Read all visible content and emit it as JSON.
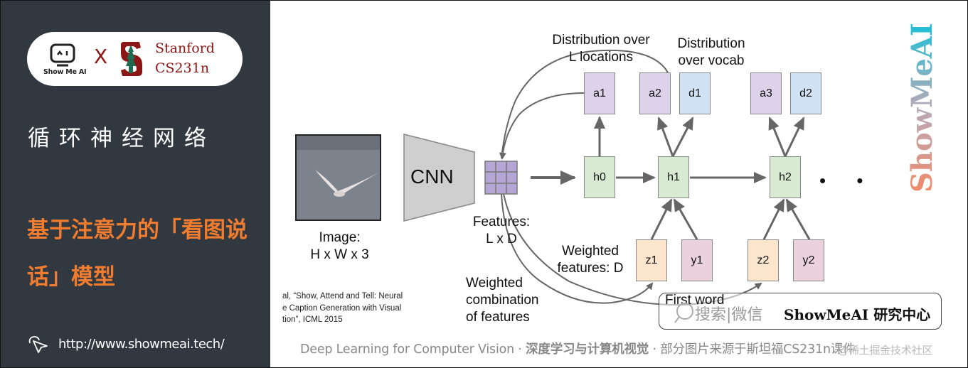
{
  "sidebar": {
    "showmeai_logo_text": "Show Me AI",
    "cross": "X",
    "stanford_line1": "Stanford",
    "stanford_line2": "CS231n",
    "section_title": "循环神经网络",
    "lesson_title": "基于注意力的「看图说话」模型",
    "url": "http://www.showmeai.tech/"
  },
  "diagram": {
    "image_label_1": "Image:",
    "image_label_2": "H x W x 3",
    "cnn_label": "CNN",
    "features_label_1": "Features:",
    "features_label_2": "L x D",
    "dist_locations_1": "Distribution over",
    "dist_locations_2": "L locations",
    "dist_vocab_1": "Distribution",
    "dist_vocab_2": "over vocab",
    "weighted_features_1": "Weighted",
    "weighted_features_2": "features: D",
    "weighted_comb_1": "Weighted",
    "weighted_comb_2": "combination",
    "weighted_comb_3": "of features",
    "first_word": "First word",
    "nodes": {
      "a1": "a1",
      "a2": "a2",
      "d1": "d1",
      "a3": "a3",
      "d2": "d2",
      "h0": "h0",
      "h1": "h1",
      "h2": "h2",
      "z1": "z1",
      "y1": "y1",
      "z2": "z2",
      "y2": "y2"
    },
    "ellipsis": "• •",
    "colors": {
      "attention": "#dcd3ea",
      "vocab": "#d0e2f3",
      "hidden": "#d9ead3",
      "weighted": "#fce5cd",
      "word": "#ead1dc",
      "feature_grid": "#b4a7d6"
    }
  },
  "citation": {
    "line1": "al, “Show, Attend and Tell: Neural",
    "line2": "e Caption Generation with Visual",
    "line3": "tion”, ICML 2015"
  },
  "search_box": {
    "grey_text": "搜索|微信",
    "bold_text": "ShowMeAI 研究中心"
  },
  "footer": {
    "part1": "Deep Learning for Computer Vision",
    "sep": " · ",
    "part2": "深度学习与计算机视觉",
    "part3": "部分图片来源于斯坦福CS231n课件",
    "watermark": "@稀土掘金技术社区"
  },
  "brand": {
    "vertical_text": "ShowMeAI",
    "accent_orange": "#f07c30",
    "stanford_red": "#8c1515",
    "sidebar_bg": "#323840"
  }
}
